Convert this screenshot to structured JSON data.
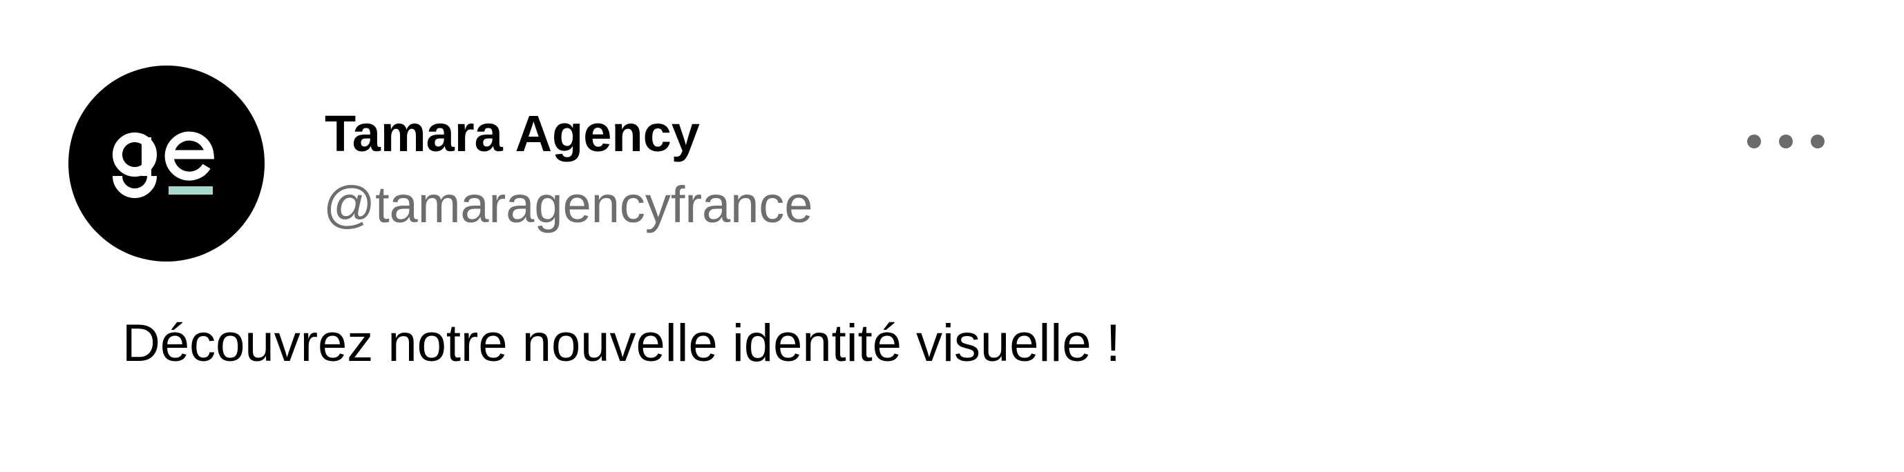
{
  "post": {
    "author": {
      "name": "Tamara Agency",
      "handle": "@tamaragencyfrance",
      "avatar": {
        "logo_text": "ge",
        "background_color": "#000000",
        "logo_color": "#ffffff",
        "accent_color": "#a6d8cf"
      }
    },
    "more_icon": "more-horizontal-icon",
    "text": "Découvrez notre nouvelle identité visuelle !"
  },
  "colors": {
    "background": "#ffffff",
    "name_text": "#000000",
    "handle_text": "#6e6e6e",
    "more_icon": "#6b6b6b"
  }
}
